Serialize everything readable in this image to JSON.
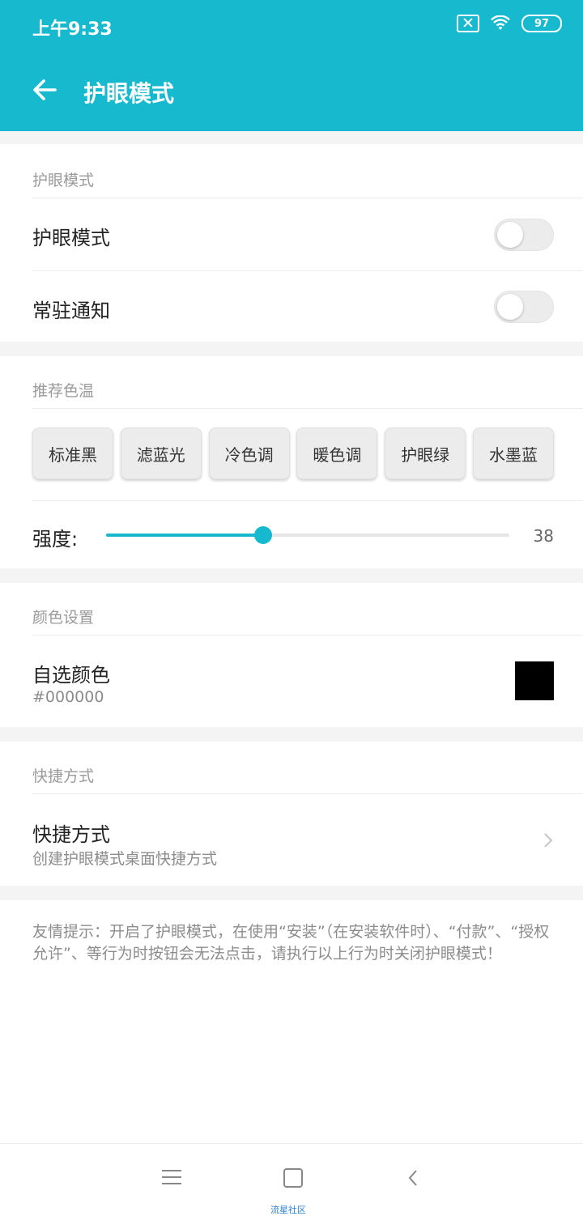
{
  "status_bar": {
    "time": "上午9:33",
    "battery": "97"
  },
  "header": {
    "title": "护眼模式"
  },
  "sections": {
    "eye_mode": {
      "label": "护眼模式",
      "toggle_eye_mode": {
        "label": "护眼模式",
        "on": false
      },
      "toggle_notification": {
        "label": "常驻通知",
        "on": false
      }
    },
    "temperature": {
      "label": "推荐色温",
      "presets": [
        "标准黑",
        "滤蓝光",
        "冷色调",
        "暖色调",
        "护眼绿",
        "水墨蓝"
      ],
      "strength_label": "强度:",
      "strength_value": "38",
      "strength_fraction": 0.39
    },
    "color": {
      "label": "颜色设置",
      "custom_title": "自选颜色",
      "custom_value": "#000000"
    },
    "shortcut": {
      "label": "快捷方式",
      "title": "快捷方式",
      "subtitle": "创建护眼模式桌面快捷方式"
    }
  },
  "tip": "友情提示：开启了护眼模式，在使用“安装”（在安装软件时）、“付款”、“授权允许”、等行为时按钮会无法点击，请执行以上行为时关闭护眼模式！",
  "watermark": "流星社区",
  "colors": {
    "accent": "#17b9cf",
    "swatch": "#000000"
  },
  "icons": [
    "back-arrow-icon",
    "sim-icon",
    "wifi-icon",
    "battery-icon",
    "chevron-right-icon",
    "menu-icon",
    "home-icon",
    "nav-back-icon"
  ]
}
